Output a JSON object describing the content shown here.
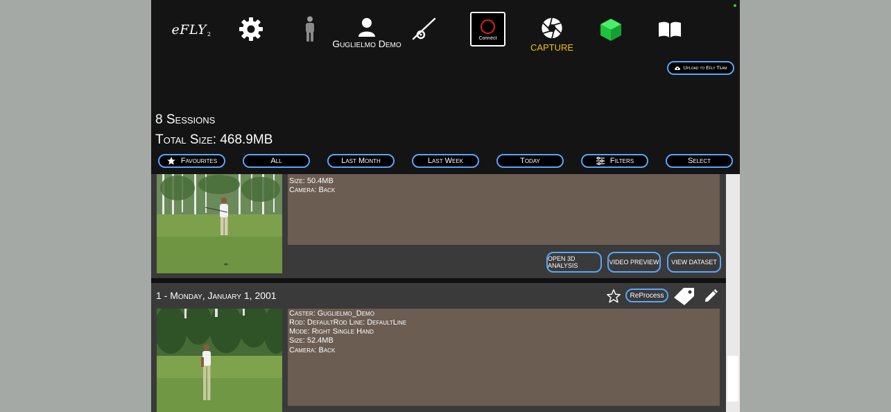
{
  "topbar": {
    "logo": {
      "text": "eFLY",
      "subscript": "2",
      "icon": "efly-logo"
    },
    "settings": {
      "icon": "gear-icon"
    },
    "figure": {
      "icon": "figure-icon"
    },
    "user": {
      "icon": "user-icon",
      "name": "Guglielmo Demo"
    },
    "rod": {
      "icon": "fishing-rod-icon"
    },
    "connect": {
      "label": "Connect",
      "icon": "record-circle-icon",
      "color": "#e02020"
    },
    "capture": {
      "label": "CAPTURE",
      "icon": "shutter-icon",
      "color": "#f0c20d"
    },
    "cube": {
      "icon": "cube-icon",
      "color": "#1fd34a"
    },
    "book": {
      "icon": "book-icon"
    }
  },
  "upload": {
    "label": "Upload to Efly Team",
    "icon": "cloud-upload-icon"
  },
  "summary": {
    "sessions": "8 Sessions",
    "total_size": "Total Size: 468.9MB"
  },
  "filters": [
    {
      "label": "Favourites",
      "icon": "star-icon"
    },
    {
      "label": "All"
    },
    {
      "label": "Last Month"
    },
    {
      "label": "Last Week"
    },
    {
      "label": "Today"
    },
    {
      "label": "Filters",
      "icon": "sliders-icon"
    },
    {
      "label": "Select"
    }
  ],
  "sessions": [
    {
      "size": "Size: 50.4MB",
      "camera": "Camera: Back",
      "actions": [
        "OPEN 3D ANALYSIS",
        "VIDEO PREVIEW",
        "VIEW DATASET"
      ]
    },
    {
      "title": "1 - Monday, January 1, 2001",
      "caster": "Caster: Guglielmo_Demo",
      "rod": "Rod: DefaultRod Line: DefaultLine",
      "mode": "Mode: Right Single Hand",
      "size": "Size: 52.4MB",
      "camera": "Camera: Back",
      "reprocess": "ReProcess"
    }
  ],
  "colors": {
    "accent": "#58a7ff",
    "card": "#3a3a3a",
    "info_bg": "#6b5d52",
    "background": "#141414"
  }
}
